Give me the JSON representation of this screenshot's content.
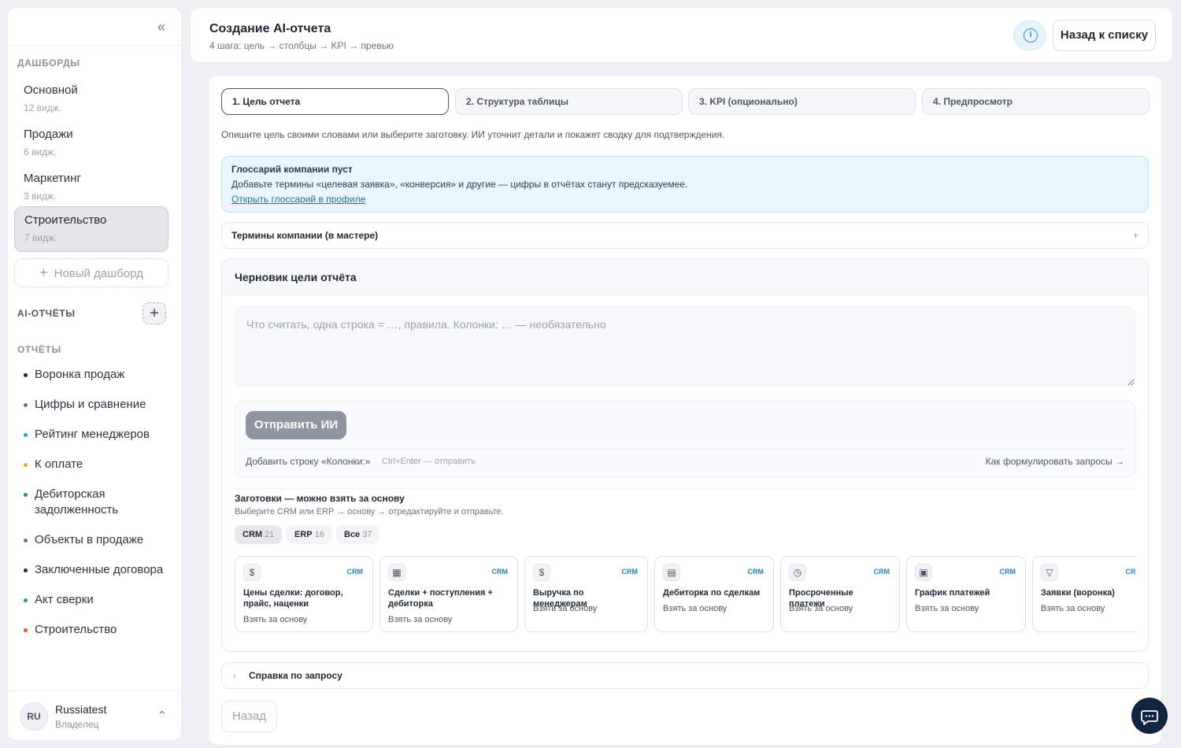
{
  "sidebar": {
    "dashboards_heading": "ДАШБОРДЫ",
    "dashboards": [
      {
        "name": "Основной",
        "count": "12 видж."
      },
      {
        "name": "Продажи",
        "count": "6 видж."
      },
      {
        "name": "Маркетинг",
        "count": "3 видж."
      },
      {
        "name": "Строительство",
        "count": "7 видж."
      }
    ],
    "new_dashboard": "Новый дашборд",
    "ai_reports_heading": "AI-ОТЧЁТЫ",
    "reports_heading": "ОТЧЁТЫ",
    "reports": [
      {
        "name": "Воронка продаж",
        "color": "#1f2733"
      },
      {
        "name": "Цифры и сравнение",
        "color": "#6b7280"
      },
      {
        "name": "Рейтинг менеджеров",
        "color": "#1ea7d8"
      },
      {
        "name": "К оплате",
        "color": "#f0a020"
      },
      {
        "name": "Дебиторская задолженность",
        "color": "#1f9d55"
      },
      {
        "name": "Объекты в продаже",
        "color": "#6b7280"
      },
      {
        "name": "Заключенные договора",
        "color": "#1f2733"
      },
      {
        "name": "Акт сверки",
        "color": "#16a085"
      },
      {
        "name": "Строительство",
        "color": "#e8572a"
      }
    ],
    "user": {
      "initials": "RU",
      "name": "Russiatest",
      "role": "Владелец"
    }
  },
  "header": {
    "title": "Создание AI-отчета",
    "subtitle": "4 шага: цель → столбцы → KPI → превью",
    "back_to_list": "Назад к списку"
  },
  "steps": [
    "1. Цель отчета",
    "2. Структура таблицы",
    "3. KPI (опционально)",
    "4. Предпросмотр"
  ],
  "intro": "Опишите цель своими словами или выберите заготовку. ИИ уточнит детали и покажет сводку для подтверждения.",
  "glossary": {
    "title": "Глоссарий компании пуст",
    "text": "Добавьте термины «целевая заявка», «конверсия» и другие — цифры в отчётах станут предсказуемее.",
    "link": "Открыть глоссарий в профиле"
  },
  "terms": {
    "label": "Термины компании (в мастере)",
    "icon": "+"
  },
  "draft": {
    "title": "Черновик цели отчёта",
    "placeholder": "Что считать, одна строка = …, правила. Колонки: … — необязательно",
    "send": "Отправить ИИ",
    "add_row": "Добавить строку «Колонки:»",
    "hint": "Ctrl+Enter — отправить",
    "howto": "Как формулировать запросы →"
  },
  "templates": {
    "title": "Заготовки — можно взять за основу",
    "subtitle": "Выберите CRM или ERP → основу → отредактируйте и отправьте.",
    "filters": [
      {
        "label": "CRM",
        "count": "21"
      },
      {
        "label": "ERP",
        "count": "16"
      },
      {
        "label": "Все",
        "count": "37"
      }
    ],
    "cards": [
      {
        "title": "Цены сделки: договор, прайс, наценки",
        "tag": "CRM",
        "action": "Взять за основу",
        "icon": "dollar-icon"
      },
      {
        "title": "Сделки + поступления + дебиторка",
        "tag": "CRM",
        "action": "Взять за основу",
        "icon": "table-icon"
      },
      {
        "title": "Выручка по менеджерам",
        "tag": "CRM",
        "action": "Взять за основу",
        "icon": "dollar-icon"
      },
      {
        "title": "Дебиторка по сделкам",
        "tag": "CRM",
        "action": "Взять за основу",
        "icon": "clipboard-icon"
      },
      {
        "title": "Просроченные платежи",
        "tag": "CRM",
        "action": "Взять за основу",
        "icon": "clock-icon"
      },
      {
        "title": "График платежей",
        "tag": "CRM",
        "action": "Взять за основу",
        "icon": "calendar-icon"
      },
      {
        "title": "Заявки (воронка)",
        "tag": "CRM",
        "action": "Взять за основу",
        "icon": "filter-icon"
      }
    ]
  },
  "help": "Справка по запросу",
  "back": "Назад"
}
